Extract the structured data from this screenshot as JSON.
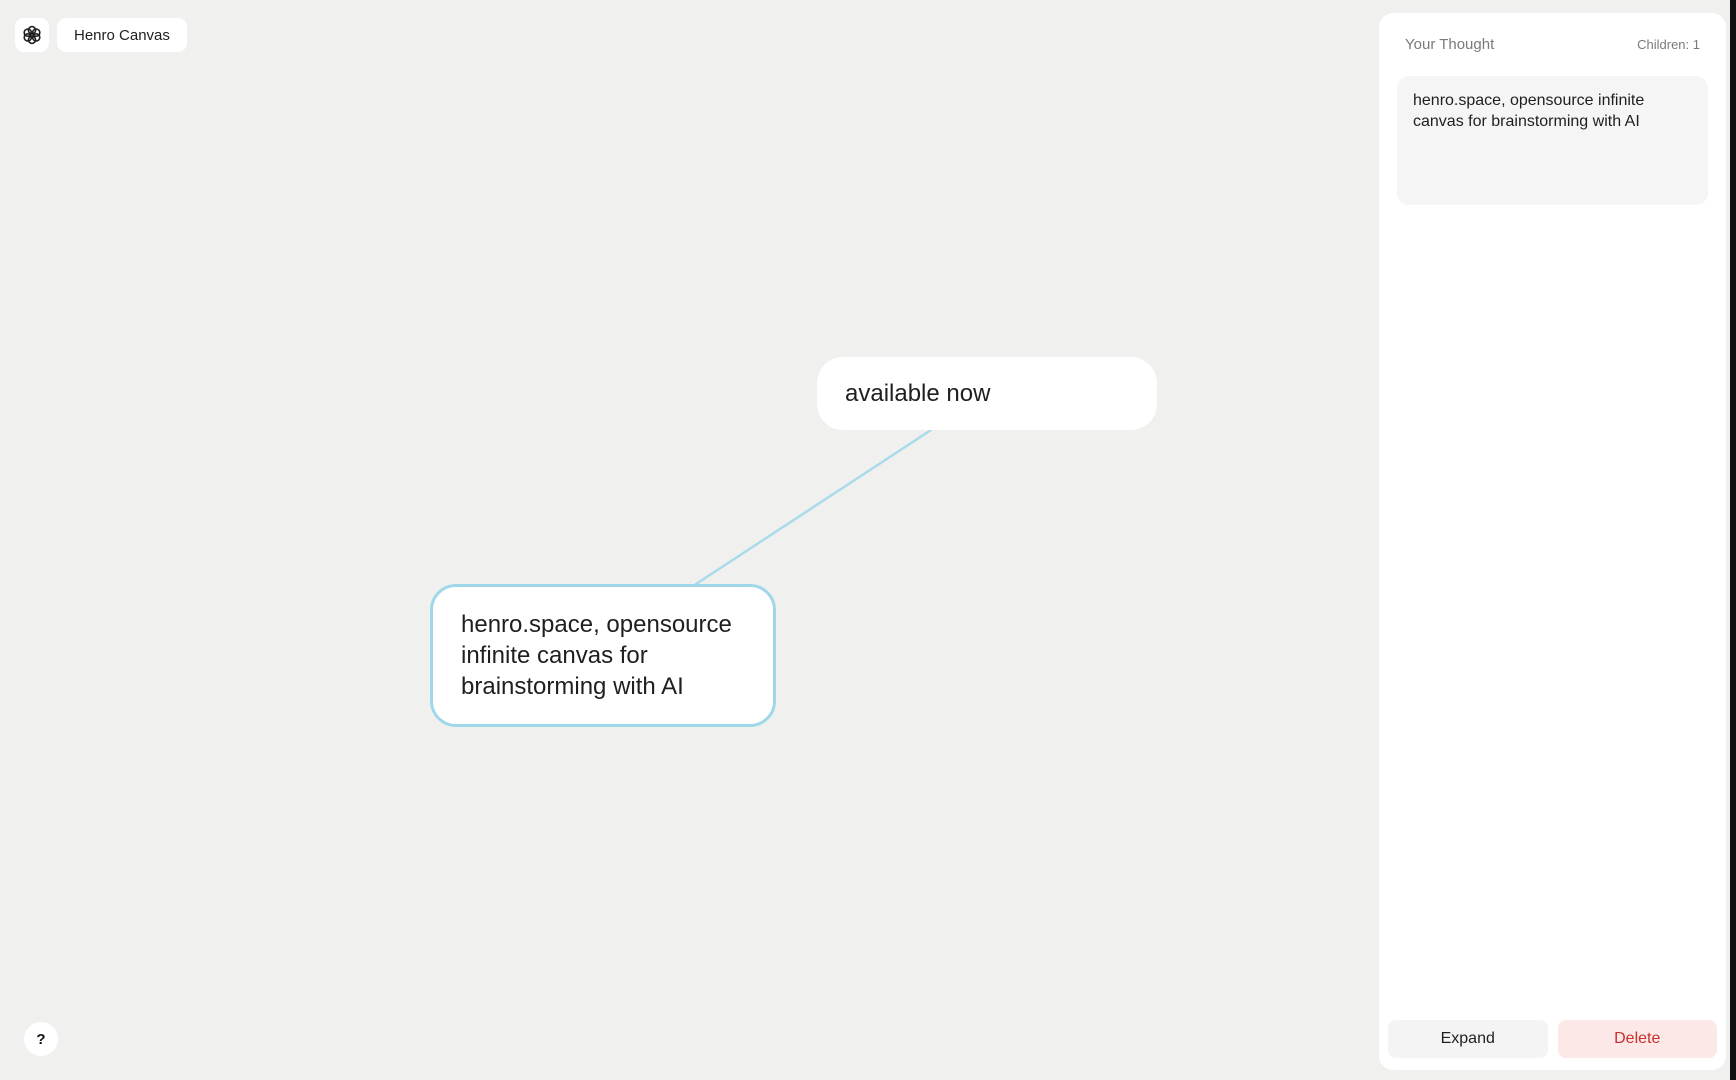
{
  "app": {
    "title": "Henro Canvas",
    "logo_icon": "flower-logo-icon",
    "help_label": "?"
  },
  "canvas": {
    "nodes": [
      {
        "text": "available now",
        "selected": false
      },
      {
        "text": "henro.space, opensource infinite canvas for brainstorming with AI",
        "selected": true
      }
    ],
    "edge_color": "#9fd8ea",
    "selected_border_color": "#9fd8ea"
  },
  "panel": {
    "title": "Your Thought",
    "children_label": "Children: 1",
    "thought_text": "henro.space, opensource infinite canvas for brainstorming with AI",
    "expand_label": "Expand",
    "delete_label": "Delete",
    "delete_color": "#c8312f"
  }
}
